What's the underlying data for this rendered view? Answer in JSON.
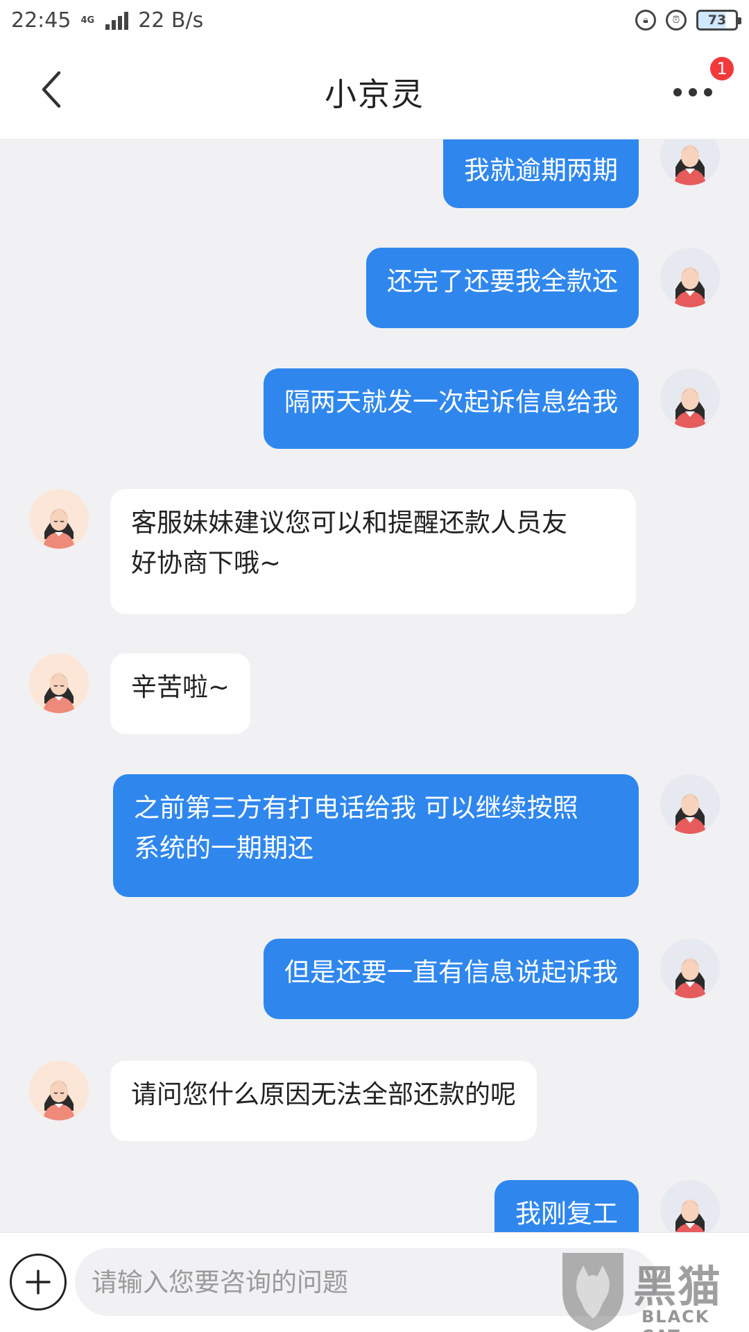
{
  "status_bar": {
    "time": "22:45",
    "network": "4G",
    "speed": "22 B/s",
    "battery": "73"
  },
  "header": {
    "title": "小京灵",
    "notification_count": "1"
  },
  "messages": [
    {
      "sender": "user",
      "text": "我就逾期两期"
    },
    {
      "sender": "user",
      "text": "还完了还要我全款还"
    },
    {
      "sender": "user",
      "text": "隔两天就发一次起诉信息给我"
    },
    {
      "sender": "agent",
      "text": "客服妹妹建议您可以和提醒还款人员友\n好协商下哦~"
    },
    {
      "sender": "agent",
      "text": "辛苦啦~"
    },
    {
      "sender": "user",
      "text": "之前第三方有打电话给我 可以继续按照\n系统的一期期还"
    },
    {
      "sender": "user",
      "text": "但是还要一直有信息说起诉我"
    },
    {
      "sender": "agent",
      "text": "请问您什么原因无法全部还款的呢"
    },
    {
      "sender": "user",
      "text": "我刚复工"
    }
  ],
  "input": {
    "placeholder": "请输入您要咨询的问题"
  },
  "watermark": {
    "main": "黑猫",
    "sub": "BLACK CAT"
  },
  "colors": {
    "outgoing_bubble": "#2f87ee",
    "incoming_bubble": "#ffffff",
    "background": "#f1f1f3",
    "badge": "#f23a3a"
  }
}
